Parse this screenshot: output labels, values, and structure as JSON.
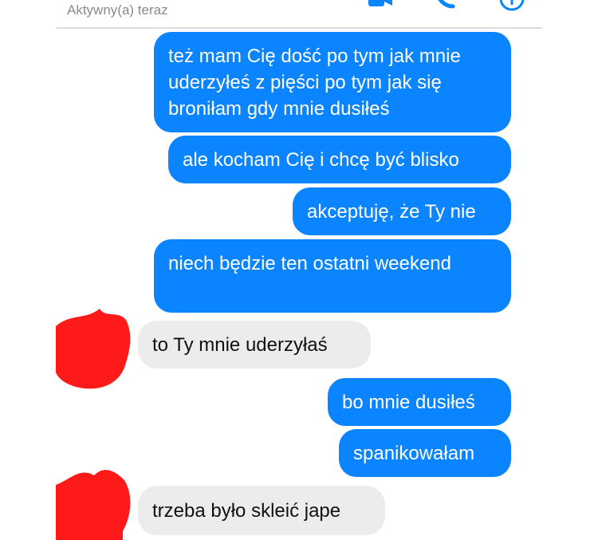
{
  "header": {
    "status": "Aktywny(a) teraz",
    "icons": [
      "video-call-icon",
      "phone-call-icon",
      "info-icon"
    ],
    "accent": "#0a84ff"
  },
  "colors": {
    "outgoing_bubble": "#0a84ff",
    "incoming_bubble": "#ececec",
    "avatar_scribble": "#ff1a1a"
  },
  "messages": [
    {
      "direction": "out",
      "text": "też mam Cię dość po tym jak mnie uderzyłeś  z pięści po tym jak się broniłam gdy mnie dusiłeś"
    },
    {
      "direction": "out",
      "text": "ale kocham Cię i chcę być blisko"
    },
    {
      "direction": "out",
      "text": "akceptuję, że Ty nie"
    },
    {
      "direction": "out",
      "text": "niech będzie ten ostatni weekend"
    },
    {
      "direction": "in",
      "text": "to Ty mnie uderzyłaś"
    },
    {
      "direction": "out",
      "text": "bo mnie dusiłeś"
    },
    {
      "direction": "out",
      "text": "spanikowałam"
    },
    {
      "direction": "in",
      "text": "trzeba było skleić jape"
    }
  ]
}
